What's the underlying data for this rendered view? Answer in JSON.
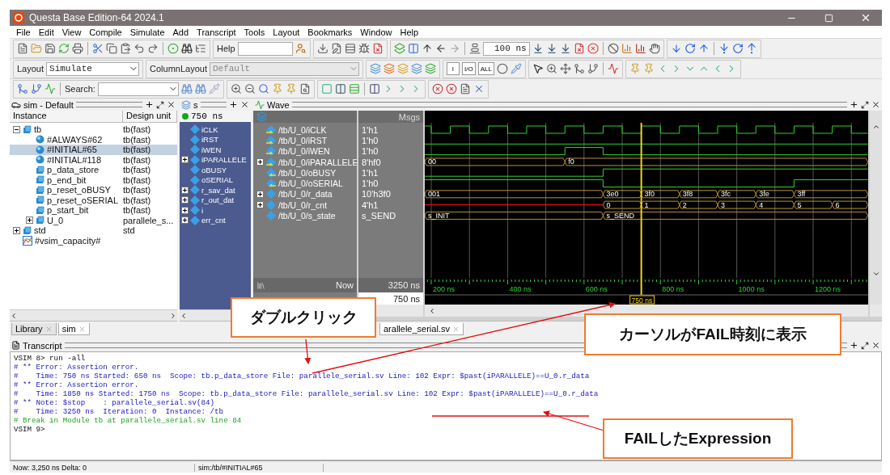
{
  "window": {
    "title": "Questa Base Edition-64 2024.1"
  },
  "menu": [
    "File",
    "Edit",
    "View",
    "Compile",
    "Simulate",
    "Add",
    "Transcript",
    "Tools",
    "Layout",
    "Bookmarks",
    "Window",
    "Help"
  ],
  "toolbar": {
    "help_label": "Help",
    "step_value": "100 ns",
    "layout_label": "Layout",
    "layout_value": "Simulate",
    "column_layout_label": "ColumnLayout",
    "column_layout_value": "Default",
    "search_label": "Search:",
    "filter_buttons": [
      "I",
      "I/O",
      "ALL"
    ]
  },
  "sim_panel": {
    "title": "sim - Default",
    "columns": [
      "Instance",
      "Design unit"
    ],
    "tree": [
      {
        "name": "tb",
        "unit": "tb(fast)",
        "kind": "module",
        "expanded": true,
        "selected": false,
        "children": [
          {
            "name": "#ALWAYS#62",
            "unit": "tb(fast)",
            "kind": "process",
            "selected": false
          },
          {
            "name": "#INITIAL#65",
            "unit": "tb(fast)",
            "kind": "process",
            "selected": true
          },
          {
            "name": "#INITIAL#118",
            "unit": "tb(fast)",
            "kind": "process",
            "selected": false
          },
          {
            "name": "p_data_store",
            "unit": "tb(fast)",
            "kind": "module",
            "selected": false
          },
          {
            "name": "p_end_bit",
            "unit": "tb(fast)",
            "kind": "module",
            "selected": false
          },
          {
            "name": "p_reset_oBUSY",
            "unit": "tb(fast)",
            "kind": "module",
            "selected": false
          },
          {
            "name": "p_reset_oSERIAL",
            "unit": "tb(fast)",
            "kind": "module",
            "selected": false
          },
          {
            "name": "p_start_bit",
            "unit": "tb(fast)",
            "kind": "module",
            "selected": false
          },
          {
            "name": "U_0",
            "unit": "parallele_s...",
            "kind": "module",
            "expanded": false,
            "selected": false
          }
        ]
      },
      {
        "name": "std",
        "unit": "std",
        "kind": "module",
        "expanded": false,
        "selected": false
      },
      {
        "name": "#vsim_capacity#",
        "kind": "capacity",
        "selected": false
      }
    ],
    "tabs": [
      {
        "label": "Library",
        "selected": false
      },
      {
        "label": "sim",
        "selected": true
      }
    ]
  },
  "objects_panel": {
    "title": "s",
    "time": "750 ns",
    "items": [
      {
        "name": "iCLK",
        "expandable": false
      },
      {
        "name": "iRST",
        "expandable": false
      },
      {
        "name": "iWEN",
        "expandable": false
      },
      {
        "name": "iPARALLELE",
        "expandable": true
      },
      {
        "name": "oBUSY",
        "expandable": false
      },
      {
        "name": "oSERIAL",
        "expandable": false
      },
      {
        "name": "r_sav_dat",
        "expandable": true
      },
      {
        "name": "r_out_dat",
        "expandable": true
      },
      {
        "name": "i",
        "expandable": true
      },
      {
        "name": "err_cnt",
        "expandable": true
      }
    ]
  },
  "wave": {
    "title": "Wave",
    "msgs_header": "Msgs",
    "signals": [
      {
        "path": "/tb/U_0/iCLK",
        "value": "1'h1",
        "input": true,
        "output": false,
        "expandable": false,
        "kind": "clock"
      },
      {
        "path": "/tb/U_0/iRST",
        "value": "1'h0",
        "input": true,
        "output": false,
        "expandable": false,
        "kind": "bit"
      },
      {
        "path": "/tb/U_0/iWEN",
        "value": "1'h0",
        "input": true,
        "output": false,
        "expandable": false,
        "kind": "bit"
      },
      {
        "path": "/tb/U_0/iPARALLELE",
        "value": "8'hf0",
        "input": true,
        "output": false,
        "expandable": true,
        "kind": "bus",
        "segments": [
          "00",
          "f0"
        ]
      },
      {
        "path": "/tb/U_0/oBUSY",
        "value": "1'h1",
        "input": false,
        "output": true,
        "expandable": false,
        "kind": "bit"
      },
      {
        "path": "/tb/U_0/oSERIAL",
        "value": "1'h0",
        "input": false,
        "output": true,
        "expandable": false,
        "kind": "bit"
      },
      {
        "path": "/tb/U_0/r_data",
        "value": "10'h3f0",
        "input": false,
        "output": false,
        "expandable": true,
        "kind": "bus",
        "segments": [
          "001",
          "3e0",
          "3f0",
          "3f8",
          "3fc",
          "3fe",
          "3ff"
        ]
      },
      {
        "path": "/tb/U_0/r_cnt",
        "value": "4'h1",
        "input": false,
        "output": false,
        "expandable": true,
        "kind": "bus",
        "segments": [
          "0",
          "1",
          "2",
          "3",
          "4",
          "5",
          "6"
        ]
      },
      {
        "path": "/tb/U_0/s_state",
        "value": "s_SEND",
        "input": false,
        "output": false,
        "expandable": false,
        "kind": "bus",
        "segments": [
          "s_INIT",
          "s_SEND"
        ]
      }
    ],
    "now_label": "Now",
    "now_value": "3250 ns",
    "cursor_value": "750 ns",
    "cursor_label": "750 ns",
    "axis_labels": [
      "200 ns",
      "400 ns",
      "600 ns",
      "800 ns",
      "1000 ns",
      "1200 ns"
    ],
    "source_tab": "arallele_serial.sv"
  },
  "transcript": {
    "title": "Transcript",
    "lines": [
      {
        "kind": "prompt",
        "text": "VSIM 8> run -all"
      },
      {
        "kind": "message",
        "text": "# ** Error: Assertion error."
      },
      {
        "kind": "message",
        "text": "#    Time: 750 ns Started: 650 ns  Scope: tb.p_data_store File: parallele_serial.sv Line: 102 Expr: $past(iPARALLELE)==U_0.r_data"
      },
      {
        "kind": "message",
        "text": "# ** Error: Assertion error."
      },
      {
        "kind": "message",
        "text": "#    Time: 1850 ns Started: 1750 ns  Scope: tb.p_data_store File: parallele_serial.sv Line: 102 Expr: $past(iPARALLELE)==U_0.r_data"
      },
      {
        "kind": "message",
        "text": "# ** Note: $stop    : parallele_serial.sv(84)"
      },
      {
        "kind": "message",
        "text": "#    Time: 3250 ns  Iteration: 0  Instance: /tb"
      },
      {
        "kind": "break",
        "text": "# Break in Module tb at parallele_serial.sv line 84"
      },
      {
        "kind": "prompt",
        "text": "VSIM 9>"
      }
    ]
  },
  "status_bar": {
    "time": "Now: 3,250 ns  Delta: 0",
    "context": "sim:/tb/#INITIAL#65"
  },
  "callouts": [
    "ダブルクリック",
    "カーソルがFAIL時刻に表示",
    "FAILしたExpression"
  ]
}
